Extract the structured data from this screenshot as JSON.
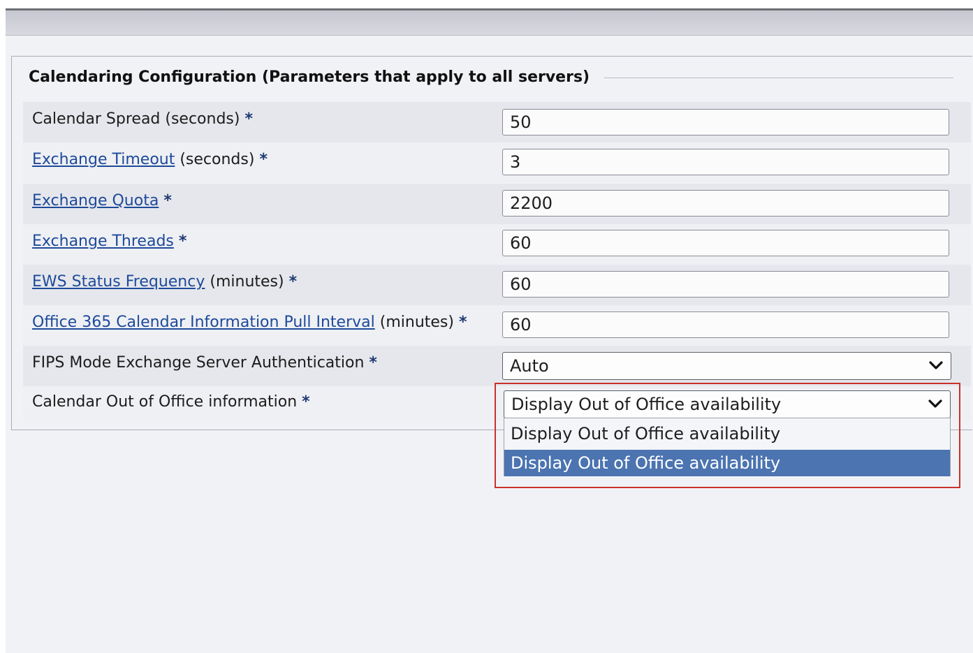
{
  "section": {
    "title": "Calendaring Configuration (Parameters that apply to all servers)"
  },
  "fields": [
    {
      "link": "",
      "label": "Calendar Spread (seconds) ",
      "required": "*",
      "value": "50"
    },
    {
      "link": "Exchange Timeout",
      "label": " (seconds) ",
      "required": "*",
      "value": "3"
    },
    {
      "link": "Exchange Quota",
      "label": " ",
      "required": "*",
      "value": "2200"
    },
    {
      "link": "Exchange Threads",
      "label": " ",
      "required": "*",
      "value": "60"
    },
    {
      "link": "EWS Status Frequency",
      "label": " (minutes) ",
      "required": "*",
      "value": "60"
    },
    {
      "link": "Office 365 Calendar Information Pull Interval",
      "label": " (minutes) ",
      "required": "*",
      "value": "60"
    }
  ],
  "fips": {
    "label": "FIPS Mode Exchange Server Authentication ",
    "required": "*",
    "selected": "Auto",
    "icon": "chevron-down-icon"
  },
  "out_of_office": {
    "label": "Calendar Out of Office information ",
    "required": "*",
    "selected": "Display Out of Office availability",
    "icon": "chevron-down-icon",
    "options": [
      "Display Out of Office availability",
      "Display Out of Office availability"
    ],
    "highlighted_option": "Display Out of Office availability"
  },
  "colors": {
    "link": "#1d4a9a",
    "selection": "#4b74b0",
    "highlight_border": "#c8322a"
  }
}
